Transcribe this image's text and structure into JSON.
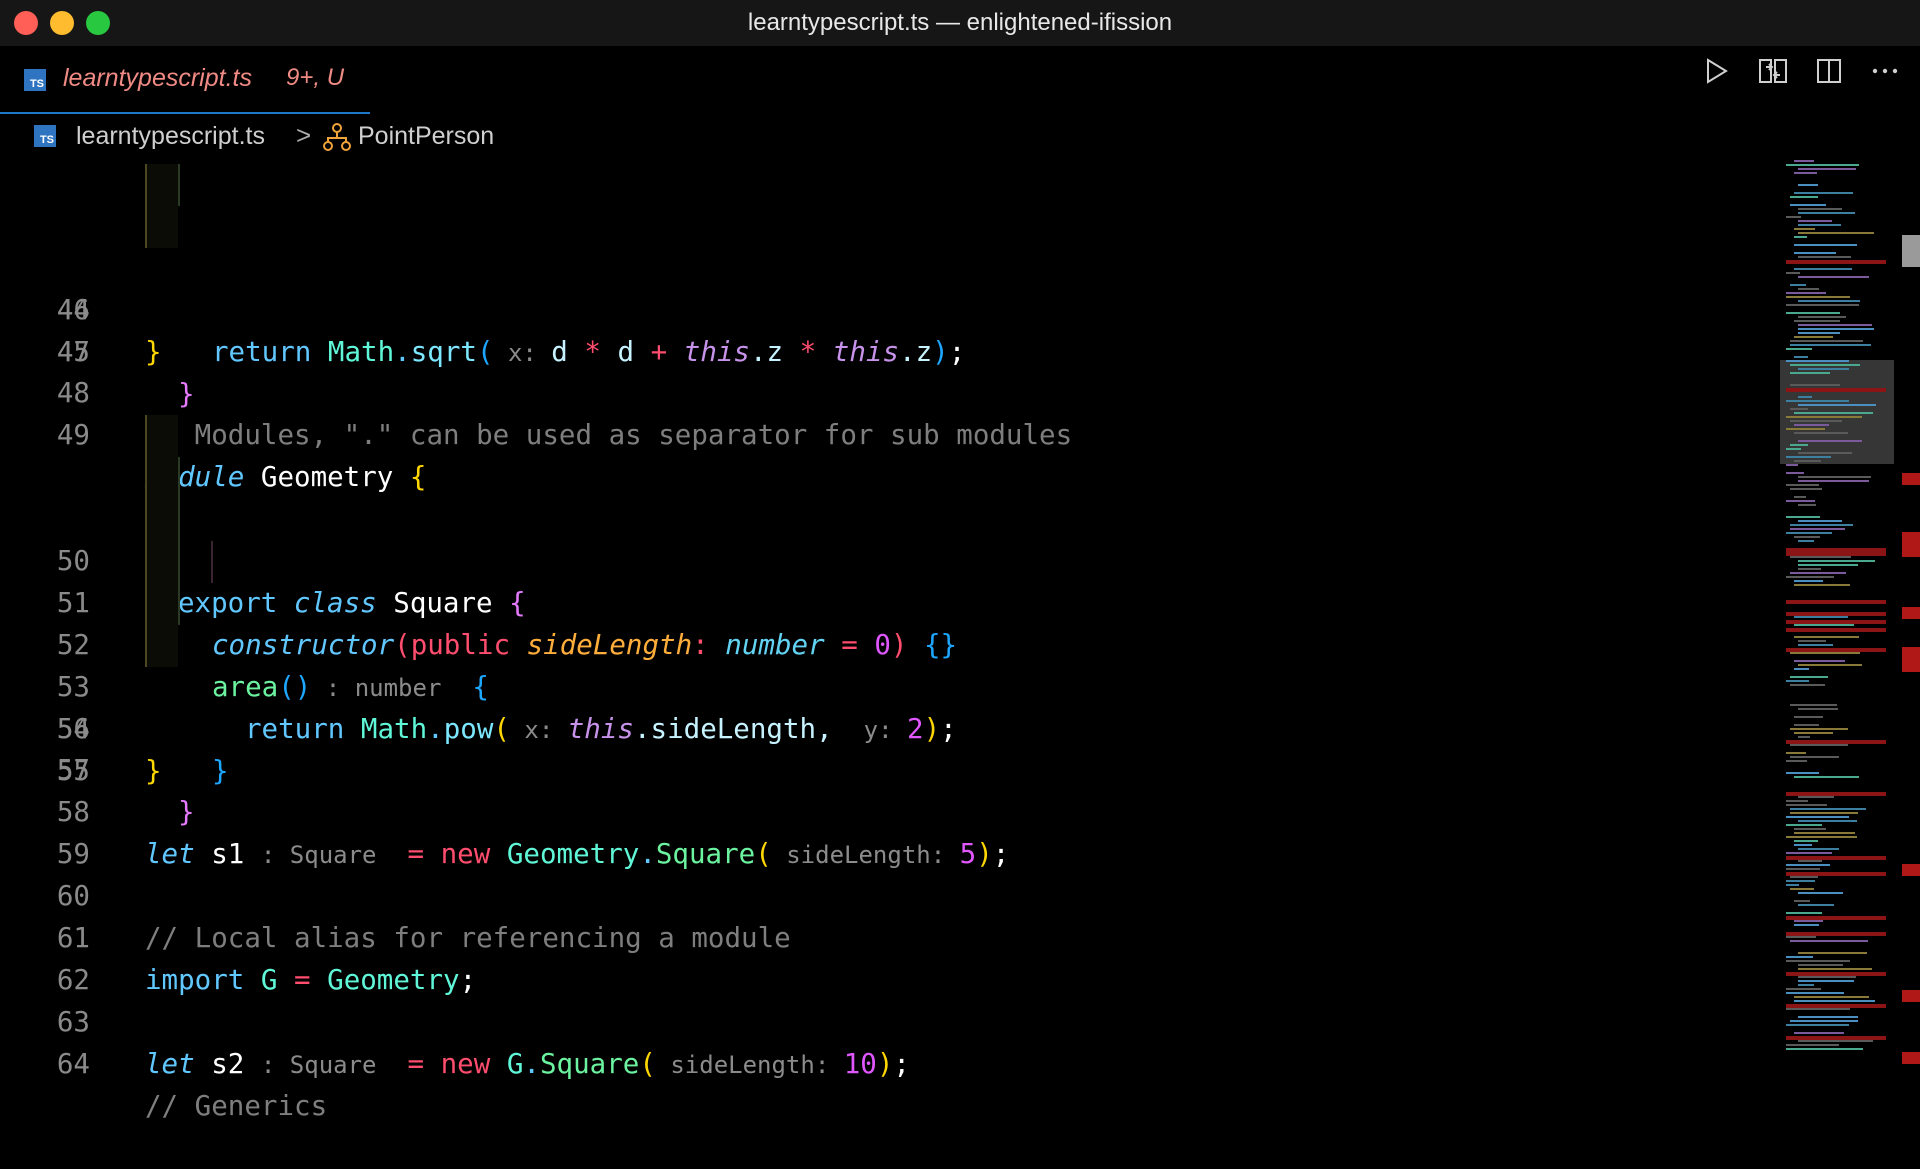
{
  "window": {
    "title": "learntypescript.ts — enlightened-ifission"
  },
  "colors": {
    "close": "#ff5f57",
    "minimize": "#febc2e",
    "maximize": "#28c840",
    "accent": "#1e78c9",
    "modified": "#f08a84"
  },
  "tab": {
    "badge": "TS",
    "label": "learntypescript.ts",
    "status": "9+, U"
  },
  "editor_actions": [
    {
      "name": "run-icon"
    },
    {
      "name": "compare-changes-icon"
    },
    {
      "name": "split-editor-icon"
    },
    {
      "name": "more-actions-icon"
    }
  ],
  "breadcrumb": {
    "badge": "TS",
    "file": "learntypescript.ts",
    "separator": ">",
    "symbol": "PointPerson"
  },
  "code": {
    "line_numbers": [
      "44",
      "45",
      "46",
      "47",
      "48",
      "49",
      "50",
      "51",
      "52",
      "53",
      "54",
      "55",
      "56",
      "57",
      "58",
      "59",
      "60",
      "61",
      "62",
      "63",
      "64"
    ],
    "l44": {
      "ret": "return",
      "math": "Math",
      "dot": ".",
      "sqrt": "sqrt",
      "open": "(",
      "hint": " x: ",
      "d1": "d",
      "op1": " * ",
      "d2": "d",
      "op2": " + ",
      "this1": "this",
      "z1": ".z",
      "op3": " * ",
      "this2": "this",
      "z2": ".z",
      "close": ")",
      "semi": ";"
    },
    "l45": {
      "brace": "}"
    },
    "l46": {
      "brace": "}"
    },
    "l48": {
      "comment": "// Modules, \".\" can be used as separator for sub modules"
    },
    "l49": {
      "kw": "module",
      "name": " Geometry ",
      "brace": "{"
    },
    "l50": {
      "kw": "export",
      "kw2": "class",
      "name": " Square ",
      "brace": "{"
    },
    "l51": {
      "ctor": "constructor",
      "open": "(",
      "pub": "public",
      "param": "sideLength",
      "colon": ": ",
      "type": "number",
      "eq": " = ",
      "val": "0",
      "close": ")",
      "braces": " {}"
    },
    "l52": {
      "fn": "area",
      "parens": "()",
      "hint": " : number ",
      "brace": " {"
    },
    "l53": {
      "ret": "return",
      "math": "Math",
      "dot": ".",
      "fn": "pow",
      "open": "(",
      "hint": " x: ",
      "this": "this",
      "prop": ".sideLength, ",
      "hint2": " y: ",
      "val": "2",
      "close": ")",
      "semi": ";"
    },
    "l54": {
      "brace": "}"
    },
    "l55": {
      "brace": "}"
    },
    "l56": {
      "brace": "}"
    },
    "l58": {
      "kw": "let",
      "name": " s1 ",
      "hint": ": Square ",
      "eq": " = ",
      "new": "new",
      "ns": " Geometry",
      "dot": ".",
      "cls": "Square",
      "open": "(",
      "hint2": " sideLength: ",
      "val": "5",
      "close": ")",
      "semi": ";"
    },
    "l60": {
      "comment": "// Local alias for referencing a module"
    },
    "l61": {
      "kw": "import",
      "name": " G ",
      "eq": "= ",
      "ns": "Geometry",
      "semi": ";"
    },
    "l63": {
      "kw": "let",
      "name": " s2 ",
      "hint": ": Square ",
      "eq": " = ",
      "new": "new",
      "ns": " G",
      "dot": ".",
      "cls": "Square",
      "open": "(",
      "hint2": " sideLength: ",
      "val": "10",
      "close": ")",
      "semi": ";"
    },
    "l65": {
      "comment": "// Generics"
    }
  }
}
